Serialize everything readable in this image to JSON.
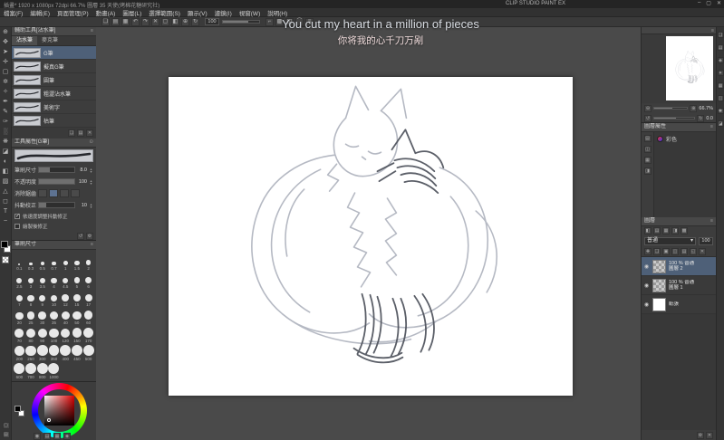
{
  "titlebar": {
    "title_left": "插畫* 1920 x 1080px 72dpi 66.7% 圖層 35 天使(烤棉花糖研究社)",
    "app_name": "CLIP STUDIO PAINT EX",
    "window_controls": [
      {
        "icon_name": "minimize-icon",
        "glyph": "–"
      },
      {
        "icon_name": "maximize-icon",
        "glyph": "▢"
      },
      {
        "icon_name": "close-icon",
        "glyph": "✕"
      }
    ]
  },
  "menubar": {
    "items": [
      "檔案(F)",
      "編輯(E)",
      "頁面管理(P)",
      "動畫(A)",
      "圖層(L)",
      "選擇範圍(S)",
      "顯示(V)",
      "濾鏡(I)",
      "視窗(W)",
      "說明(H)"
    ]
  },
  "command_bar": {
    "icons": [
      {
        "icon_name": "new-file-icon",
        "glyph": "❏"
      },
      {
        "icon_name": "open-file-icon",
        "glyph": "▤"
      },
      {
        "icon_name": "save-icon",
        "glyph": "▦"
      },
      {
        "icon_name": "undo-icon",
        "glyph": "↶"
      },
      {
        "icon_name": "redo-icon",
        "glyph": "↷"
      },
      {
        "icon_name": "delete-icon",
        "glyph": "✕"
      },
      {
        "icon_name": "clear-selection-icon",
        "glyph": "▢"
      },
      {
        "icon_name": "fill-icon",
        "glyph": "◧"
      },
      {
        "icon_name": "zoom-in-icon",
        "glyph": "⊕"
      },
      {
        "icon_name": "rotate-view-icon",
        "glyph": "↻"
      }
    ],
    "opacity_value": "100",
    "icons2": [
      {
        "icon_name": "snap-ruler-icon",
        "glyph": "⌐"
      },
      {
        "icon_name": "snap-grid-icon",
        "glyph": "▩"
      },
      {
        "icon_name": "snap-special-ruler-icon",
        "glyph": "◫"
      },
      {
        "icon_name": "ruler-icon",
        "glyph": "⌒"
      },
      {
        "icon_name": "workspace-settings-icon",
        "glyph": "≡"
      }
    ]
  },
  "subtitles": {
    "line1": "You cut my heart in a million of pieces",
    "line2": "你将我的心千刀万剐"
  },
  "tool_strip": {
    "tools": [
      {
        "icon_name": "zoom-tool-icon",
        "glyph": "⊕"
      },
      {
        "icon_name": "move-view-tool-icon",
        "glyph": "✥"
      },
      {
        "icon_name": "operation-tool-icon",
        "glyph": "➤"
      },
      {
        "icon_name": "layer-move-tool-icon",
        "glyph": "✛"
      },
      {
        "icon_name": "selection-tool-icon",
        "glyph": "▢"
      },
      {
        "icon_name": "auto-select-tool-icon",
        "glyph": "✲"
      },
      {
        "icon_name": "eyedropper-tool-icon",
        "glyph": "✧"
      },
      {
        "icon_name": "pen-tool-icon",
        "glyph": "✒"
      },
      {
        "icon_name": "pencil-tool-icon",
        "glyph": "✎"
      },
      {
        "icon_name": "brush-tool-icon",
        "glyph": "✑"
      },
      {
        "icon_name": "airbrush-tool-icon",
        "glyph": "░"
      },
      {
        "icon_name": "decoration-tool-icon",
        "glyph": "❋"
      },
      {
        "icon_name": "eraser-tool-icon",
        "glyph": "◪"
      },
      {
        "icon_name": "blend-tool-icon",
        "glyph": "◐"
      },
      {
        "icon_name": "fill-tool-icon",
        "glyph": "◧"
      },
      {
        "icon_name": "gradient-tool-icon",
        "glyph": "▨"
      },
      {
        "icon_name": "figure-tool-icon",
        "glyph": "△"
      },
      {
        "icon_name": "frame-border-tool-icon",
        "glyph": "◻"
      },
      {
        "icon_name": "text-tool-icon",
        "glyph": "T"
      },
      {
        "icon_name": "correct-line-tool-icon",
        "glyph": "~"
      }
    ]
  },
  "subtool_panel": {
    "title": "輔助工具[沾水筆]",
    "tabs": [
      {
        "label": "沾水筆",
        "active": true
      },
      {
        "label": "麥克筆",
        "active": false
      }
    ],
    "brushes": [
      {
        "name": "G筆",
        "selected": true
      },
      {
        "name": "擬真G筆",
        "selected": false
      },
      {
        "name": "圓筆",
        "selected": false
      },
      {
        "name": "粗澀沾水筆",
        "selected": false
      },
      {
        "name": "美術字",
        "selected": false
      },
      {
        "name": "枯筆",
        "selected": false
      }
    ],
    "footer_icons": [
      {
        "icon_name": "duplicate-subtool-icon",
        "glyph": "❏"
      },
      {
        "icon_name": "subtool-menu-icon",
        "glyph": "▤"
      },
      {
        "icon_name": "delete-subtool-icon",
        "glyph": "✕"
      }
    ]
  },
  "tool_property_panel": {
    "title": "工具屬性[G筆]",
    "rows": [
      {
        "label": "筆刷尺寸",
        "value": "8.0"
      },
      {
        "label": "不透明度",
        "value": "100"
      },
      {
        "label": "消除鋸齒",
        "value": ""
      },
      {
        "label": "抖動校正",
        "value": "10"
      }
    ],
    "options": [
      {
        "label": "依速度調整抖動修正",
        "checked": true
      },
      {
        "label": "繪製後修正",
        "checked": false
      }
    ],
    "footer_icons": [
      {
        "icon_name": "reset-property-icon",
        "glyph": "↺"
      },
      {
        "icon_name": "detail-settings-icon",
        "glyph": "⚙"
      }
    ]
  },
  "brush_size_panel": {
    "title": "筆刷尺寸",
    "sizes": [
      "0.1",
      "0.3",
      "0.5",
      "0.7",
      "1",
      "1.5",
      "2",
      "2.5",
      "3",
      "3.5",
      "4",
      "4.5",
      "5",
      "6",
      "7",
      "8",
      "9",
      "10",
      "12",
      "15",
      "17",
      "20",
      "25",
      "30",
      "35",
      "40",
      "50",
      "60",
      "70",
      "80",
      "90",
      "100",
      "120",
      "150",
      "170",
      "200",
      "250",
      "300",
      "350",
      "400",
      "450",
      "500",
      "600",
      "700",
      "800",
      "1000"
    ]
  },
  "color_wheel_panel": {
    "buttons": [
      {
        "icon_name": "color-wheel-icon",
        "glyph": "◉"
      },
      {
        "icon_name": "color-slider-icon",
        "glyph": "▤"
      },
      {
        "icon_name": "color-set-icon",
        "glyph": "▦"
      },
      {
        "icon_name": "color-history-icon",
        "glyph": "◈"
      }
    ]
  },
  "navigator_panel": {
    "zoom_value": "66.7%",
    "rotation_value": "0.0"
  },
  "layer_property_panel": {
    "title": "圖層屬性",
    "expression_label": "彩色",
    "side_icons": [
      {
        "icon_name": "effect-border-icon",
        "glyph": "▤"
      },
      {
        "icon_name": "effect-tone-icon",
        "glyph": "◫"
      },
      {
        "icon_name": "effect-layer-color-icon",
        "glyph": "▦"
      },
      {
        "icon_name": "effect-expression-icon",
        "glyph": "◨"
      }
    ]
  },
  "layer_panel": {
    "title": "圖層",
    "blend_mode": "普通",
    "opacity_value": "100",
    "top_icons": [
      {
        "icon_name": "layer-filter-icon",
        "glyph": "◧"
      },
      {
        "icon_name": "layer-search-icon",
        "glyph": "▤"
      },
      {
        "icon_name": "layer-thumbnail-icon",
        "glyph": "▦"
      },
      {
        "icon_name": "layer-lock-icon",
        "glyph": "◨"
      },
      {
        "icon_name": "layer-palette-menu-icon",
        "glyph": "▩"
      }
    ],
    "command_icons": [
      {
        "icon_name": "new-layer-icon",
        "glyph": "✚"
      },
      {
        "icon_name": "new-folder-icon",
        "glyph": "❏"
      },
      {
        "icon_name": "transfer-layer-icon",
        "glyph": "▣"
      },
      {
        "icon_name": "combine-layer-icon",
        "glyph": "◫"
      },
      {
        "icon_name": "layer-mask-icon",
        "glyph": "▤"
      },
      {
        "icon_name": "apply-mask-icon",
        "glyph": "◱"
      },
      {
        "icon_name": "delete-layer-icon",
        "glyph": "✕"
      }
    ],
    "layers": [
      {
        "eye": "◉",
        "info": "100 % 普通",
        "name": "圖層 2",
        "thumb": "checker",
        "selected": true
      },
      {
        "eye": "◉",
        "info": "100 % 普通",
        "name": "圖層 1",
        "thumb": "checker",
        "selected": false
      },
      {
        "eye": "◉",
        "info": "",
        "name": "紙張",
        "thumb": "white",
        "selected": false
      }
    ],
    "footer_icons": [
      {
        "icon_name": "layer-settings-icon",
        "glyph": "⚙"
      },
      {
        "icon_name": "layer-trash-icon",
        "glyph": "✕"
      }
    ]
  },
  "edge_strip": {
    "icons": [
      {
        "icon_name": "quick-access-icon",
        "glyph": "❏"
      },
      {
        "icon_name": "material-color-icon",
        "glyph": "▤"
      },
      {
        "icon_name": "material-monochrome-icon",
        "glyph": "◈"
      },
      {
        "icon_name": "material-manga-icon",
        "glyph": "✦"
      },
      {
        "icon_name": "material-image-icon",
        "glyph": "▦"
      },
      {
        "icon_name": "material-3d-icon",
        "glyph": "◫"
      },
      {
        "icon_name": "material-download-icon",
        "glyph": "✱"
      },
      {
        "icon_name": "history-icon",
        "glyph": "◪"
      }
    ]
  },
  "glyphs": {
    "arrow_down": "▾",
    "pin": "⊙",
    "menu": "≡",
    "zoom_out": "⊖",
    "zoom_in": "⊕",
    "fit": "▣",
    "rotate_left": "↺",
    "rotate_right": "↻",
    "spin_up": "▴",
    "spin_down": "▾"
  },
  "colors": {
    "selection_blue": "#4e6078",
    "canvas_surround": "#4a4a4a",
    "panel_bg": "#3d3d3d"
  }
}
